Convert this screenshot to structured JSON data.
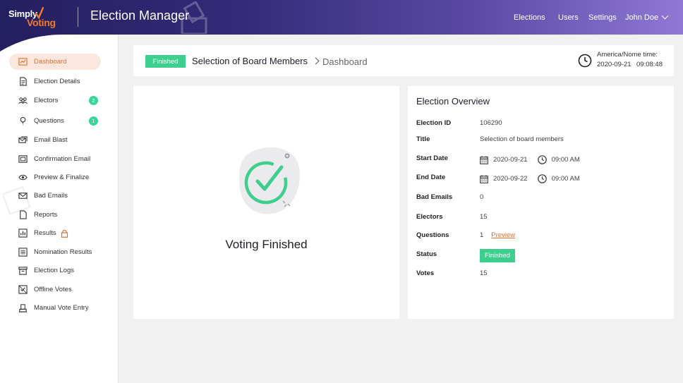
{
  "header": {
    "logo_top": "Simply",
    "logo_bottom": "Voting",
    "app_title": "Election Manager",
    "nav": [
      "Elections",
      "Users",
      "Settings"
    ],
    "user": "John Doe"
  },
  "sidebar": {
    "items": [
      {
        "label": "Dashboard",
        "icon": "dashboard-icon"
      },
      {
        "label": "Election Details",
        "icon": "document-icon"
      },
      {
        "label": "Electors",
        "icon": "people-icon",
        "badge": "2"
      },
      {
        "label": "Questions",
        "icon": "question-icon",
        "badge": "1"
      },
      {
        "label": "Email Blast",
        "icon": "email-blast-icon"
      },
      {
        "label": "Confirmation Email",
        "icon": "confirmation-email-icon"
      },
      {
        "label": "Preview & Finalize",
        "icon": "eye-icon"
      },
      {
        "label": "Bad Emails",
        "icon": "envelope-icon"
      },
      {
        "label": "Reports",
        "icon": "report-icon"
      },
      {
        "label": "Results",
        "icon": "chart-icon",
        "locked": true
      },
      {
        "label": "Nomination Results",
        "icon": "list-icon"
      },
      {
        "label": "Election Logs",
        "icon": "archive-icon"
      },
      {
        "label": "Offline Votes",
        "icon": "offline-votes-icon"
      },
      {
        "label": "Manual Vote Entry",
        "icon": "manual-entry-icon"
      }
    ]
  },
  "breadcrumb": {
    "status": "Finished",
    "election_name": "Selection of Board Members",
    "page": "Dashboard"
  },
  "timezone": {
    "label": "America/Nome time:",
    "date": "2020-09-21",
    "time": "09:08:48"
  },
  "status_card": {
    "text": "Voting Finished"
  },
  "overview": {
    "title": "Election Overview",
    "labels": {
      "election_id": "Election ID",
      "title": "Title",
      "start_date": "Start Date",
      "end_date": "End Date",
      "bad_emails": "Bad Emails",
      "electors": "Electors",
      "questions": "Questions",
      "status": "Status",
      "votes": "Votes"
    },
    "values": {
      "election_id": "106290",
      "title": "Selection of board members",
      "start_date": "2020-09-21",
      "start_time": "09:00 AM",
      "end_date": "2020-09-22",
      "end_time": "09:00 AM",
      "bad_emails": "0",
      "electors": "15",
      "questions": "1",
      "preview_link": "Preview",
      "status": "Finished",
      "votes": "15"
    }
  },
  "colors": {
    "accent": "#e0702c",
    "success": "#3ecf8e",
    "header_start": "#241f5f",
    "header_end": "#8f78d6"
  }
}
